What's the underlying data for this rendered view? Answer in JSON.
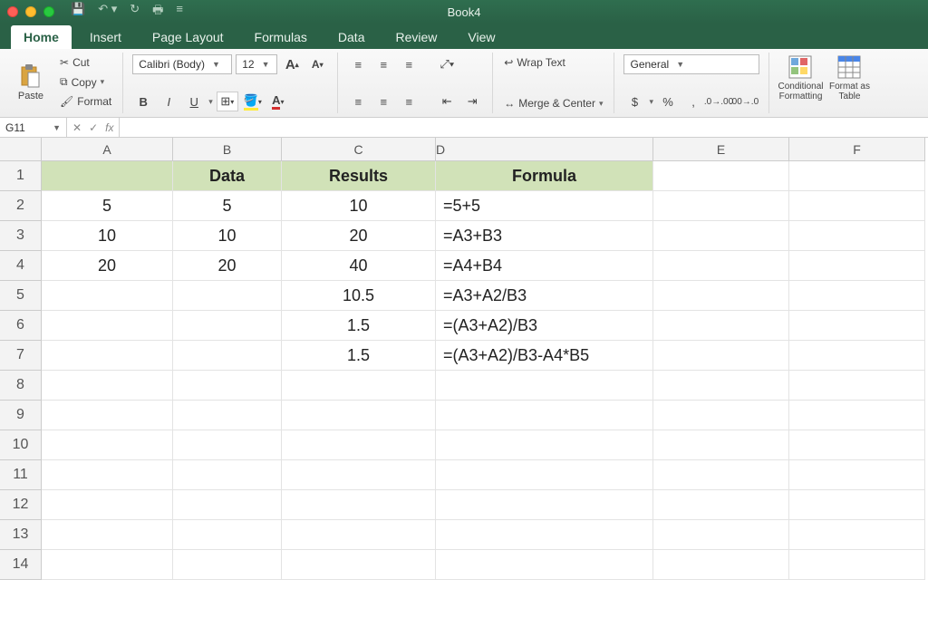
{
  "titlebar": {
    "document": "Book4"
  },
  "tabs": {
    "items": [
      "Home",
      "Insert",
      "Page Layout",
      "Formulas",
      "Data",
      "Review",
      "View"
    ],
    "active": 0
  },
  "ribbon": {
    "clipboard": {
      "paste": "Paste",
      "cut": "Cut",
      "copy": "Copy",
      "format": "Format"
    },
    "font": {
      "name": "Calibri (Body)",
      "size": "12",
      "bold": "B",
      "italic": "I",
      "underline": "U"
    },
    "increase_font": "A",
    "decrease_font": "A",
    "alignment": {
      "wrap": "Wrap Text",
      "merge": "Merge & Center"
    },
    "number": {
      "format": "General",
      "currency": "$",
      "percent": "%",
      "comma": ",",
      "inc": ".0",
      "dec": ".00"
    },
    "styles": {
      "conditional": "Conditional Formatting",
      "table": "Format as Table"
    }
  },
  "fxbar": {
    "namebox": "G11",
    "formula": ""
  },
  "grid": {
    "columns": [
      "A",
      "B",
      "C",
      "D",
      "E",
      "F"
    ],
    "rows": [
      "1",
      "2",
      "3",
      "4",
      "5",
      "6",
      "7",
      "8",
      "9",
      "10",
      "11",
      "12",
      "13",
      "14"
    ],
    "selected": "G11",
    "headers": {
      "b": "Data",
      "c": "Results",
      "d": "Formula"
    },
    "data": [
      {
        "a": "5",
        "b": "5",
        "c": "10",
        "d": "=5+5"
      },
      {
        "a": "10",
        "b": "10",
        "c": "20",
        "d": "=A3+B3"
      },
      {
        "a": "20",
        "b": "20",
        "c": "40",
        "d": "=A4+B4"
      },
      {
        "a": "",
        "b": "",
        "c": "10.5",
        "d": "=A3+A2/B3"
      },
      {
        "a": "",
        "b": "",
        "c": "1.5",
        "d": "=(A3+A2)/B3"
      },
      {
        "a": "",
        "b": "",
        "c": "1.5",
        "d": "=(A3+A2)/B3-A4*B5"
      }
    ]
  }
}
